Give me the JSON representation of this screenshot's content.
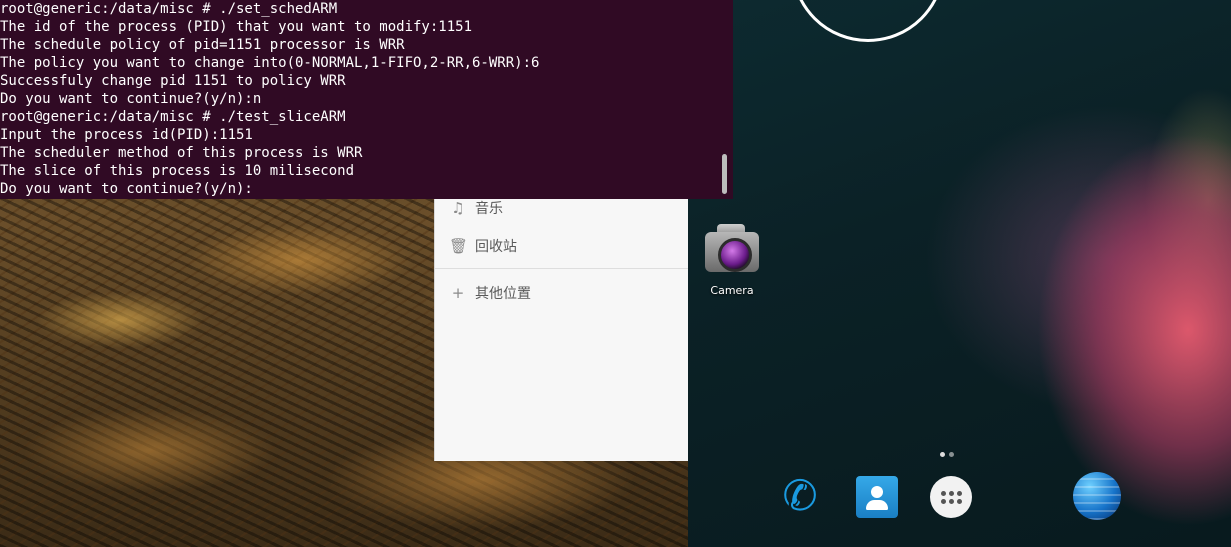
{
  "terminal": {
    "lines": [
      "root@generic:/data/misc # ./set_schedARM",
      "The id of the process (PID) that you want to modify:1151",
      "The schedule policy of pid=1151 processor is WRR",
      "The policy you want to change into(0-NORMAL,1-FIFO,2-RR,6-WRR):6",
      "Successfuly change pid 1151 to policy WRR",
      "Do you want to continue?(y/n):n",
      "root@generic:/data/misc # ./test_sliceARM",
      "Input the process id(PID):1151",
      "The scheduler method of this process is WRR",
      "The slice of this process is 10 milisecond",
      "Do you want to continue?(y/n):"
    ]
  },
  "file_manager": {
    "items": [
      {
        "label": "音乐",
        "icon": "music-note-icon"
      },
      {
        "label": "回收站",
        "icon": "trash-icon"
      },
      {
        "label": "其他位置",
        "icon": "plus-icon"
      }
    ]
  },
  "android": {
    "camera_label": "Camera",
    "dock": [
      "phone-icon",
      "contacts-icon",
      "app-drawer-icon",
      "browser-icon"
    ]
  }
}
